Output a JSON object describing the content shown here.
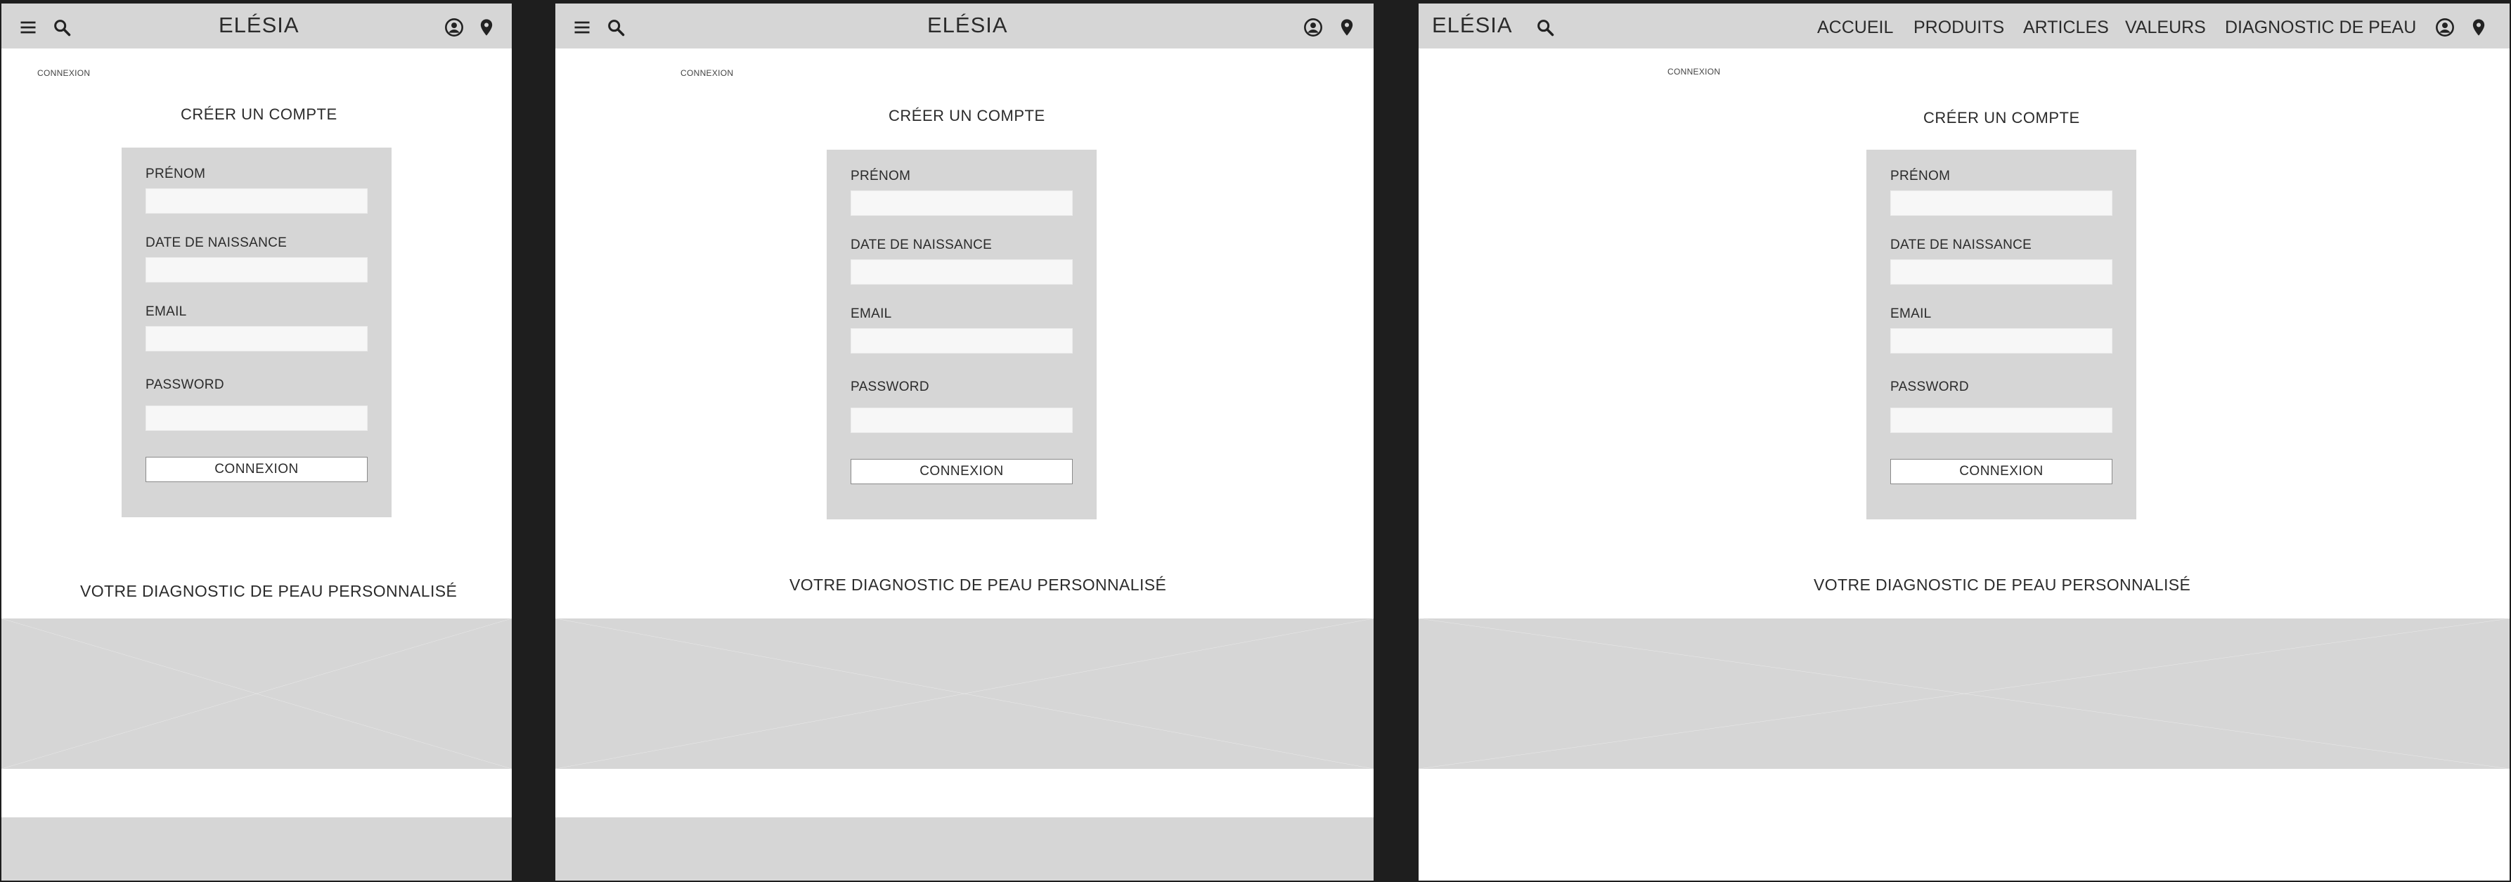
{
  "brand": {
    "logo": "ELÉSIA"
  },
  "nav": {
    "items": [
      "ACCUEIL",
      "PRODUITS",
      "ARTICLES",
      "VALEURS",
      "DIAGNOSTIC DE PEAU"
    ]
  },
  "breadcrumb": "CONNEXION",
  "page_title": "CRÉER UN COMPTE",
  "form": {
    "fields": [
      {
        "label": "PRÉNOM",
        "value": ""
      },
      {
        "label": "DATE DE NAISSANCE",
        "value": ""
      },
      {
        "label": "EMAIL",
        "value": ""
      },
      {
        "label": "PASSWORD",
        "value": ""
      }
    ],
    "submit_label": "CONNEXION"
  },
  "diagnostic_heading": "VOTRE DIAGNOSTIC DE PEAU PERSONNALISÉ",
  "icons": [
    "menu-icon",
    "search-icon",
    "account-icon",
    "location-pin-icon"
  ],
  "colors": {
    "header_bg": "#d6d6d6",
    "divider": "#1e1e1e",
    "placeholder": "#d6d6d6"
  }
}
